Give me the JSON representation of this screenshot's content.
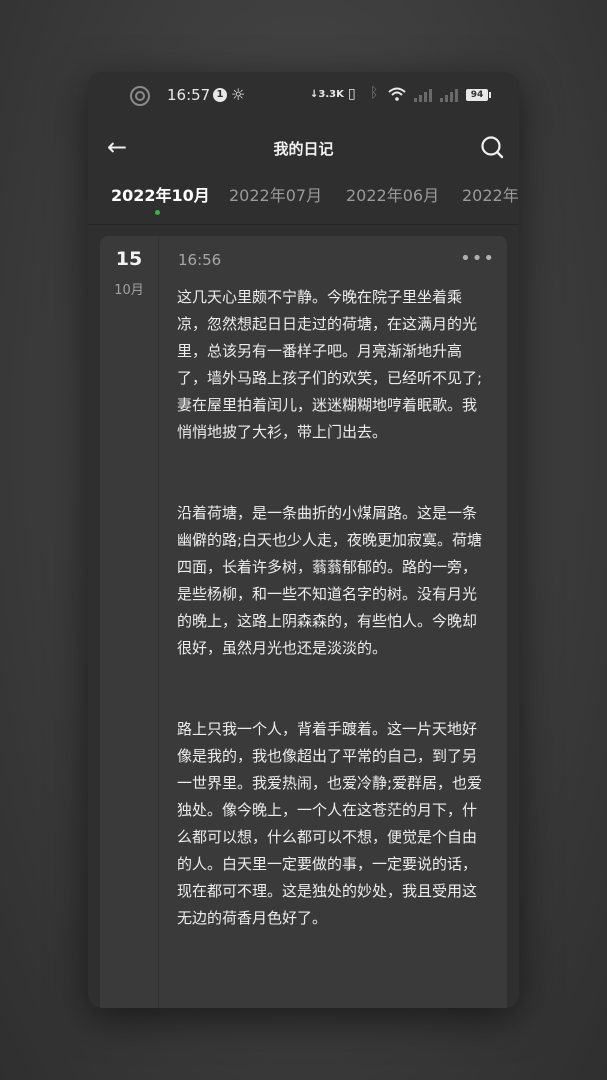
{
  "status": {
    "time": "16:57",
    "notification_count": "1",
    "net_speed": "↓3.3K",
    "battery": "94"
  },
  "header": {
    "back_label": "←",
    "title": "我的日记"
  },
  "tabs": [
    {
      "label": "2022年10月",
      "active": true
    },
    {
      "label": "2022年07月",
      "active": false
    },
    {
      "label": "2022年06月",
      "active": false
    },
    {
      "label": "2022年",
      "active": false
    }
  ],
  "entry": {
    "day": "15",
    "month": "10月",
    "time": "16:56",
    "more": "•••",
    "paragraphs": [
      "这几天心里颇不宁静。今晚在院子里坐着乘凉，忽然想起日日走过的荷塘，在这满月的光里，总该另有一番样子吧。月亮渐渐地升高了，墙外马路上孩子们的欢笑，已经听不见了;妻在屋里拍着闰儿，迷迷糊糊地哼着眠歌。我悄悄地披了大衫，带上门出去。",
      "沿着荷塘，是一条曲折的小煤屑路。这是一条幽僻的路;白天也少人走，夜晚更加寂寞。荷塘四面，长着许多树，蓊蓊郁郁的。路的一旁，是些杨柳，和一些不知道名字的树。没有月光的晚上，这路上阴森森的，有些怕人。今晚却很好，虽然月光也还是淡淡的。",
      "路上只我一个人，背着手踱着。这一片天地好像是我的，我也像超出了平常的自己，到了另一世界里。我爱热闹，也爱冷静;爱群居，也爱独处。像今晚上，一个人在这苍茫的月下，什么都可以想，什么都可以不想，便觉是个自由的人。白天里一定要做的事，一定要说的话，现在都可不理。这是独处的妙处，我且受用这无边的荷香月色好了。"
    ]
  },
  "colors": {
    "accent_dot": "#43b04a",
    "card_bg": "#3a3a3a",
    "app_bg": "#2f2f2f"
  }
}
